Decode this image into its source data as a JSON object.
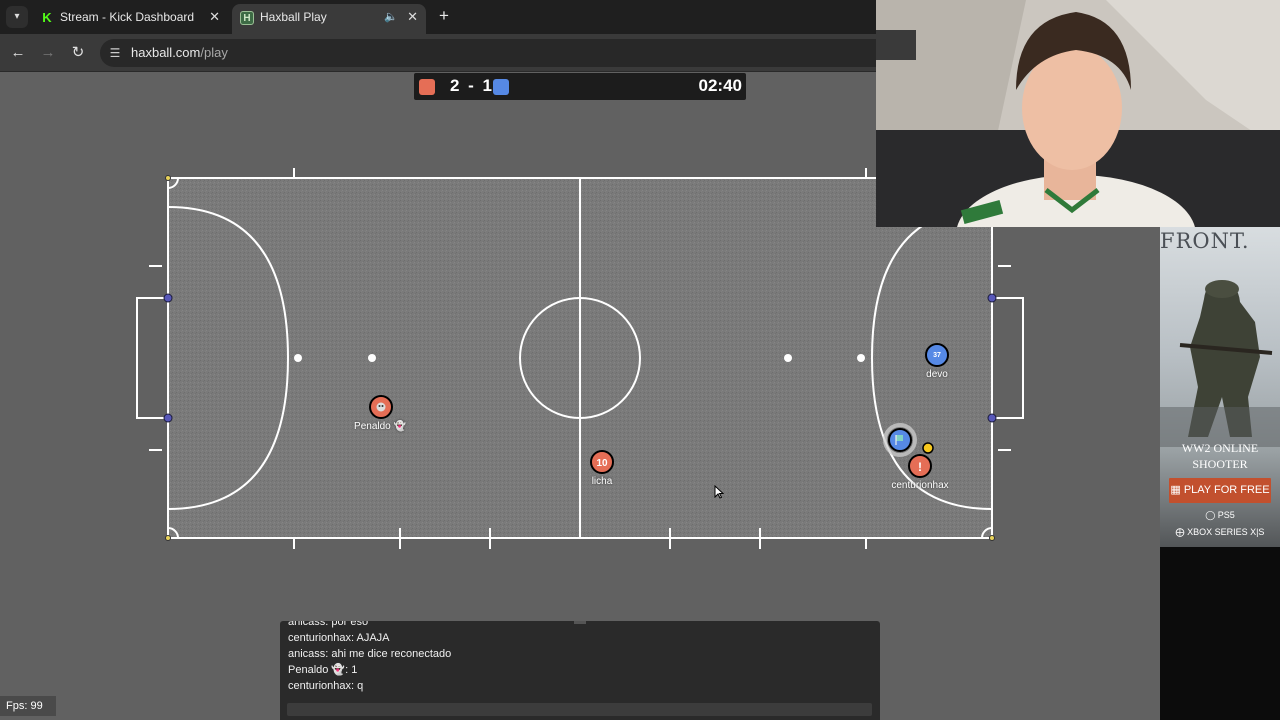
{
  "browser": {
    "tabs": [
      {
        "title": "Stream - Kick Dashboard",
        "favicon": "K"
      },
      {
        "title": "Haxball Play",
        "favicon": "H"
      }
    ],
    "url_host": "haxball.com",
    "url_path": "/play"
  },
  "scoreboard": {
    "score": "2 - 1",
    "time": "02:40",
    "red_color": "#e56e56",
    "blue_color": "#5689e5"
  },
  "players": [
    {
      "name": "Penaldo",
      "avatar": "skull-emoji",
      "team": "red",
      "name_suffix_icon": "ghost-emoji"
    },
    {
      "name": "licha",
      "avatar": "10",
      "team": "red"
    },
    {
      "name": "centurionhax",
      "avatar": "!",
      "team": "red"
    },
    {
      "name": "devo",
      "avatar": "37",
      "team": "blue"
    },
    {
      "name": "",
      "avatar": "flag-icon",
      "team": "blue"
    }
  ],
  "fps": "Fps: 99",
  "chat": {
    "lines": [
      "anicass: por eso",
      "centurionhax: AJAJA",
      "anicass: ahi me dice reconectado",
      "Penaldo 👻: 1",
      "centurionhax: q"
    ]
  },
  "ad": {
    "title": "FRONT.",
    "tagline_1": "WW2 ONLINE",
    "tagline_2": "SHOOTER",
    "cta": "PLAY FOR FREE",
    "platform_1": "PS5",
    "platform_2": "XBOX SERIES X|S"
  },
  "colors": {
    "red_team": "#e56e56",
    "blue_team": "#5689e5",
    "field_bg": "#787878",
    "page_bg": "#616161",
    "ad_cta": "#c2502e"
  }
}
